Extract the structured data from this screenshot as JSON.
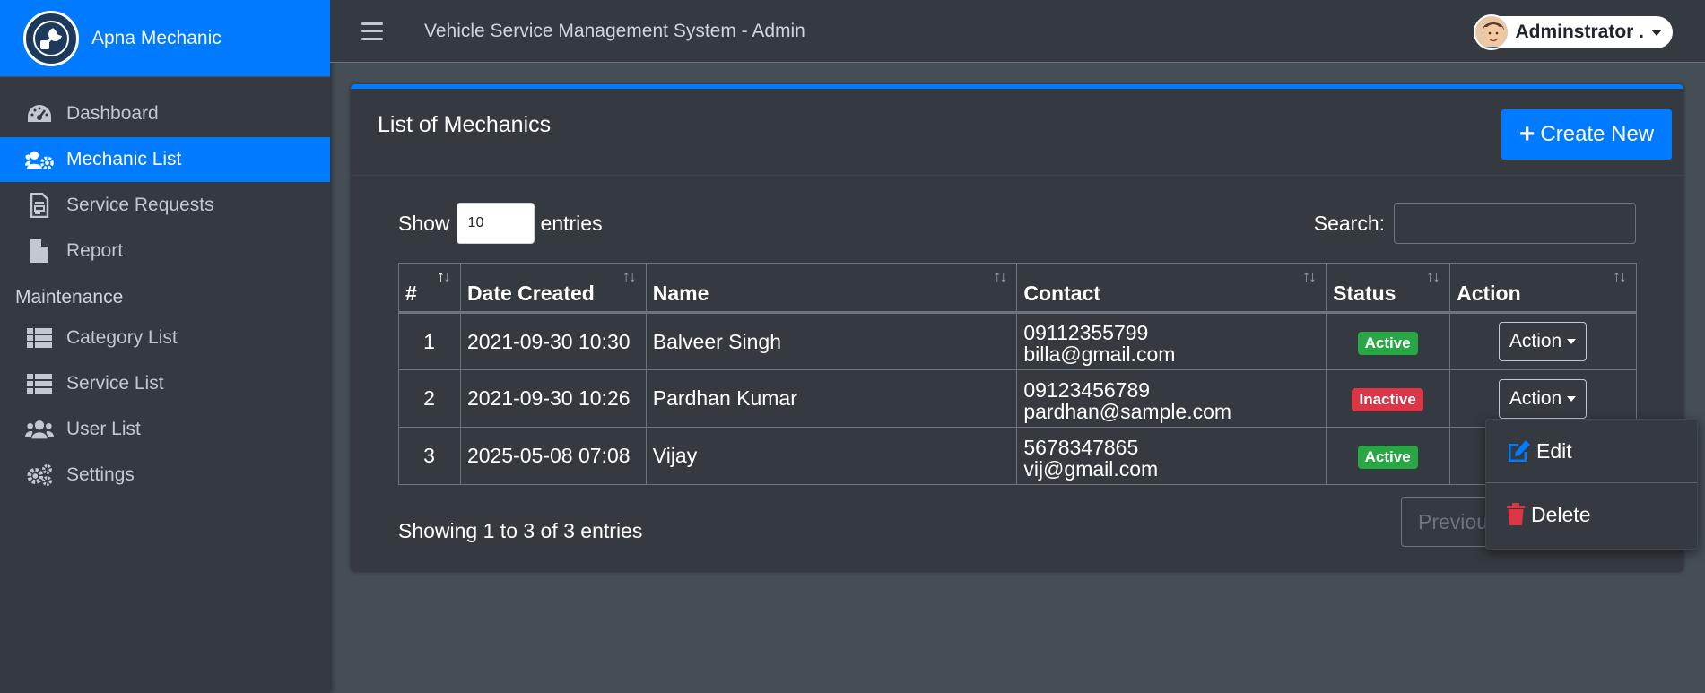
{
  "brand": {
    "name": "Apna Mechanic"
  },
  "sidebar": {
    "items": [
      {
        "label": "Dashboard",
        "icon": "tachometer-icon",
        "active": false
      },
      {
        "label": "Mechanic List",
        "icon": "users-cog-icon",
        "active": true
      },
      {
        "label": "Service Requests",
        "icon": "file-invoice-icon",
        "active": false
      },
      {
        "label": "Report",
        "icon": "file-icon",
        "active": false
      }
    ],
    "section_header": "Maintenance",
    "maintenance_items": [
      {
        "label": "Category List",
        "icon": "table-list-icon"
      },
      {
        "label": "Service List",
        "icon": "table-list-icon"
      },
      {
        "label": "User List",
        "icon": "users-icon"
      },
      {
        "label": "Settings",
        "icon": "cogs-icon"
      }
    ]
  },
  "header": {
    "title": "Vehicle Service Management System - Admin",
    "user_name": "Adminstrator ."
  },
  "card": {
    "title": "List of Mechanics",
    "create_label": "Create New",
    "show_label": "Show",
    "entries_label": "entries",
    "length_value": "10",
    "search_label": "Search:",
    "search_value": ""
  },
  "table": {
    "columns": [
      "#",
      "Date Created",
      "Name",
      "Contact",
      "Status",
      "Action"
    ],
    "rows": [
      {
        "num": "1",
        "date": "2021-09-30 10:30",
        "name": "Balveer Singh",
        "phone": "09112355799",
        "email": "billa@gmail.com",
        "status": "Active",
        "action": "Action"
      },
      {
        "num": "2",
        "date": "2021-09-30 10:26",
        "name": "Pardhan Kumar",
        "phone": "09123456789",
        "email": "pardhan@sample.com",
        "status": "Inactive",
        "action": "Action"
      },
      {
        "num": "3",
        "date": "2025-05-08 07:08",
        "name": "Vijay",
        "phone": "5678347865",
        "email": "vij@gmail.com",
        "status": "Active",
        "action": ""
      }
    ]
  },
  "footer": {
    "info": "Showing 1 to 3 of 3 entries",
    "prev_label": "Previous"
  },
  "dropdown": {
    "edit_label": "Edit",
    "delete_label": "Delete"
  },
  "colors": {
    "primary": "#007bff",
    "success": "#28a745",
    "danger": "#dc3545",
    "sidebar_bg": "#343a40",
    "body_bg": "#454d55"
  }
}
